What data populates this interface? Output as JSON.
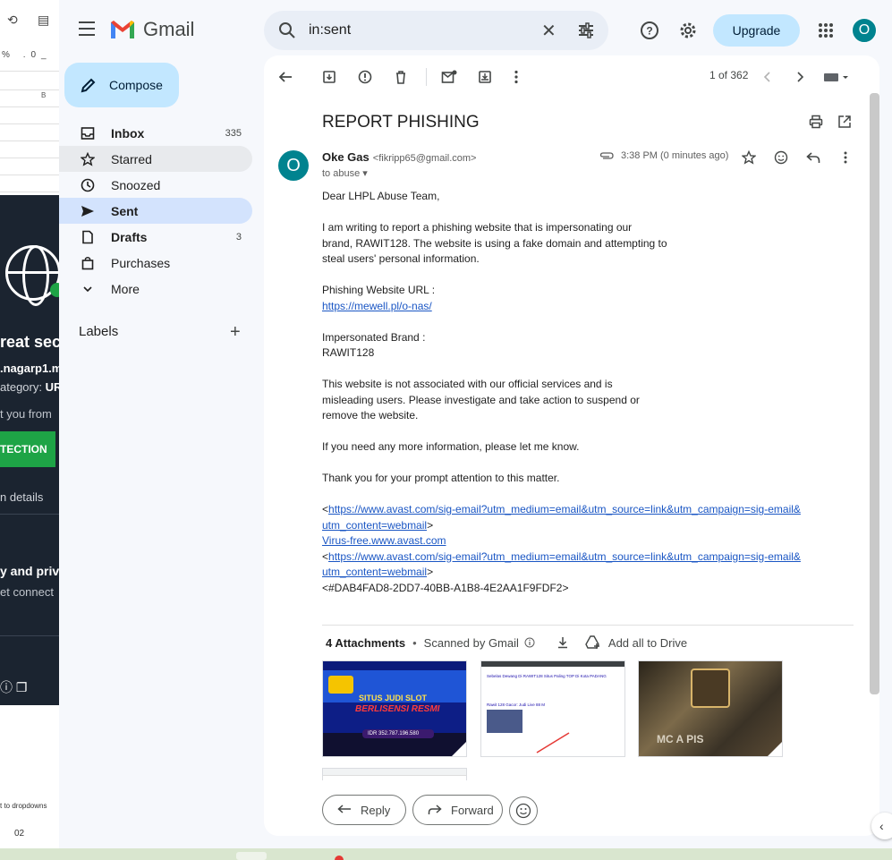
{
  "colors": {
    "accent": "#0b57d0",
    "compose_bg": "#c2e7ff",
    "active_nav": "#d3e3fd",
    "avatar": "#00838f",
    "link": "#1a56c4"
  },
  "background": {
    "sheet_col": "B",
    "sheet_percent": "%",
    "sheet_dec": ".0_",
    "sheet_dec2": ".0_",
    "avast_title": "reat sec",
    "avast_site": ".nagarp1.m",
    "avast_cat_prefix": "ategory:",
    "avast_cat_value": "UR",
    "avast_you": "t you from",
    "avast_btn": "TECTION",
    "avast_details": "n details",
    "avast_priv": "y and priv",
    "avast_conn": "et connect",
    "sheet_dropdowns": "t to dropdowns",
    "sheet_zoom": "02"
  },
  "header": {
    "app_name": "Gmail",
    "search_value": "in:sent",
    "upgrade_label": "Upgrade",
    "avatar_letter": "O"
  },
  "sidebar": {
    "compose_label": "Compose",
    "items": [
      {
        "label": "Inbox",
        "count": "335",
        "icon": "inbox-icon",
        "bold": true
      },
      {
        "label": "Starred",
        "count": "",
        "icon": "star-icon",
        "bold": false
      },
      {
        "label": "Snoozed",
        "count": "",
        "icon": "clock-icon",
        "bold": false
      },
      {
        "label": "Sent",
        "count": "",
        "icon": "send-icon",
        "bold": true,
        "active": true
      },
      {
        "label": "Drafts",
        "count": "3",
        "icon": "draft-icon",
        "bold": true
      },
      {
        "label": "Purchases",
        "count": "",
        "icon": "bag-icon",
        "bold": false
      },
      {
        "label": "More",
        "count": "",
        "icon": "chevron-down-icon",
        "bold": false
      }
    ],
    "labels_header": "Labels",
    "labels_add": "+"
  },
  "toolbar": {
    "pager": "1 of 362"
  },
  "email": {
    "subject": "REPORT PHISHING",
    "sender_avatar": "O",
    "sender_name": "Oke Gas",
    "sender_email": "<fikripp65@gmail.com>",
    "to_line": "to abuse",
    "time": "3:38 PM (0 minutes ago)",
    "greeting": "Dear LHPL Abuse Team,",
    "para1": "I am writing to report a phishing website that is impersonating our\nbrand, RAWIT128. The website is using a fake domain and attempting to\nsteal users' personal information.",
    "url_label": "Phishing Website URL :",
    "url_link": "https://mewell.pl/o-nas/",
    "brand_label": "Impersonated Brand :",
    "brand_value": "RAWIT128",
    "para2": "This website is not associated with our official services and is\nmisleading users. Please investigate and take action to suspend or\nremove the website.",
    "para3": "If you need any more information, please let me know.",
    "para4": "Thank you for your prompt attention to this matter.",
    "sig_lt1": "<",
    "sig_link1a": "https://www.avast.com/sig-email?utm_medium=email&utm_source=link&utm_campaign=sig-email&",
    "sig_link1b": "utm_content=webmail",
    "sig_gt1": ">",
    "sig_virus": "Virus-free.www.avast.com",
    "sig_lt2": "<",
    "sig_link2a": "https://www.avast.com/sig-email?utm_medium=email&utm_source=link&utm_campaign=sig-email&",
    "sig_link2b": "utm_content=webmail",
    "sig_gt2": ">",
    "sig_id": "<#DAB4FAD8-2DD7-40BB-A1B8-4E2AA1F9FDF2>"
  },
  "attachments": {
    "count_label": "4 Attachments",
    "dot": "•",
    "scanned": "Scanned by Gmail",
    "add_drive": "Add all to Drive",
    "thumb1_banner": "SITUS JUDI SLOT",
    "thumb1_sub": "BERLISENSI RESMI",
    "thumb1_amount": "IDR 352.787.196.580",
    "thumb2_title": "Sebelas Dewang Di RAWIT128 Situs Paling TOP Di Kota PADANG",
    "thumb2_link": "Rawit 128 Gacor: Judi Live 88 M",
    "thumb3_text": "MC  A  PIS"
  },
  "actions": {
    "reply_label": "Reply",
    "forward_label": "Forward"
  }
}
